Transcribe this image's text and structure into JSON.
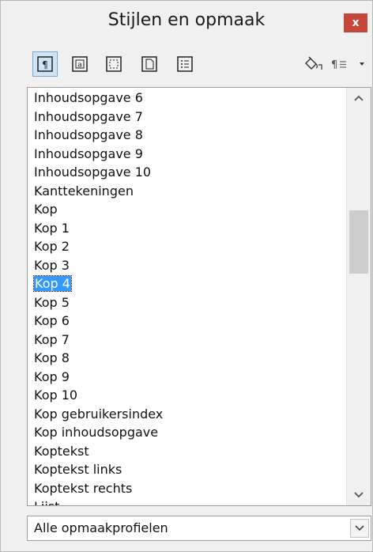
{
  "window": {
    "title": "Stijlen en opmaak",
    "close_label": "x"
  },
  "toolbar": {
    "buttons": [
      {
        "name": "paragraph-styles",
        "active": true
      },
      {
        "name": "character-styles",
        "active": false
      },
      {
        "name": "frame-styles",
        "active": false
      },
      {
        "name": "page-styles",
        "active": false
      },
      {
        "name": "list-styles",
        "active": false
      }
    ],
    "fill_format_icon": "paint-bucket-icon",
    "new_style_icon": "pilcrow-menu-icon"
  },
  "styles_list": {
    "items": [
      "Inhoudsopgave 6",
      "Inhoudsopgave 7",
      "Inhoudsopgave 8",
      "Inhoudsopgave 9",
      "Inhoudsopgave 10",
      "Kanttekeningen",
      "Kop",
      "Kop 1",
      "Kop 2",
      "Kop 3",
      "Kop 4",
      "Kop 5",
      "Kop 6",
      "Kop 7",
      "Kop 8",
      "Kop 9",
      "Kop 10",
      "Kop gebruikersindex",
      "Kop inhoudsopgave",
      "Koptekst",
      "Koptekst links",
      "Koptekst rechts",
      "Lijst"
    ],
    "selected_index": 10
  },
  "filter": {
    "value": "Alle opmaakprofielen"
  },
  "colors": {
    "selection": "#3399ff",
    "close_button": "#c7463a"
  }
}
